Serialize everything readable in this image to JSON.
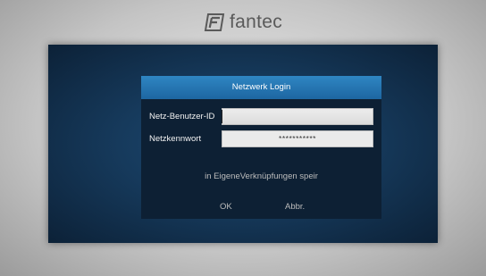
{
  "brand": {
    "name": "fantec"
  },
  "dialog": {
    "title": "Netzwerk Login",
    "user_label": "Netz-Benutzer-ID",
    "user_value": "",
    "password_label": "Netzkennwort",
    "password_value": "***********",
    "save_option": "in EigeneVerknüpfungen speir",
    "ok_label": "OK",
    "cancel_label": "Abbr."
  },
  "colors": {
    "title_bar": "#1d66a1",
    "dialog_bg": "#0d2034",
    "stage_bg": "#163a5c"
  }
}
